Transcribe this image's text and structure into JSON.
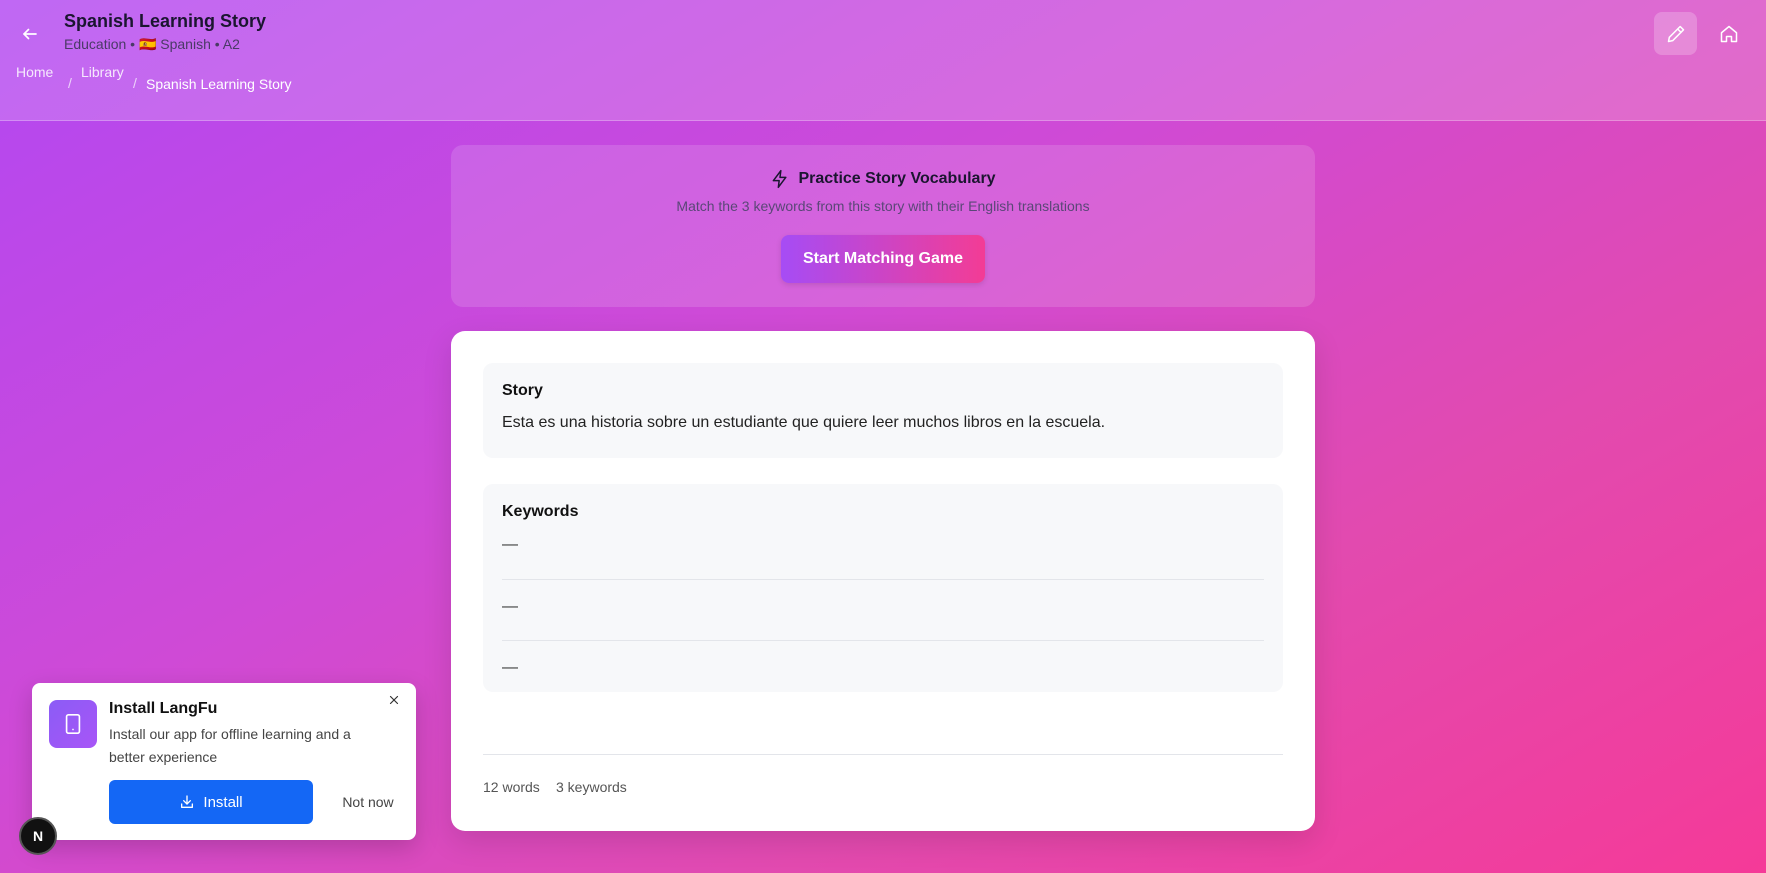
{
  "header": {
    "title": "Spanish Learning Story",
    "subtitle": "Education • 🇪🇸 Spanish • A2",
    "breadcrumb": {
      "home": "Home",
      "library": "Library",
      "current": "Spanish Learning Story",
      "separator": "/"
    }
  },
  "practice": {
    "title": "Practice Story Vocabulary",
    "description": "Match the 3 keywords from this story with their English translations",
    "button_label": "Start Matching Game"
  },
  "story": {
    "heading": "Story",
    "text": "Esta es una historia sobre un estudiante que quiere leer muchos libros en la escuela."
  },
  "keywords": {
    "heading": "Keywords",
    "items": [
      "—",
      "—",
      "—"
    ]
  },
  "stats": {
    "words": "12 words",
    "keywords": "3 keywords"
  },
  "install_prompt": {
    "title": "Install LangFu",
    "description": "Install our app for offline learning and a better experience",
    "install_label": "Install",
    "dismiss_label": "Not now"
  },
  "badge": {
    "label": "N"
  },
  "colors": {
    "accent_gradient_start": "#a64cf5",
    "accent_gradient_end": "#f33c95",
    "install_button": "#1467f5"
  },
  "icons": {
    "back": "arrow-left-icon",
    "edit": "pencil-icon",
    "home": "home-icon",
    "practice": "lightning-icon",
    "install_app": "tablet-icon",
    "install_button": "download-icon",
    "close": "close-icon"
  }
}
